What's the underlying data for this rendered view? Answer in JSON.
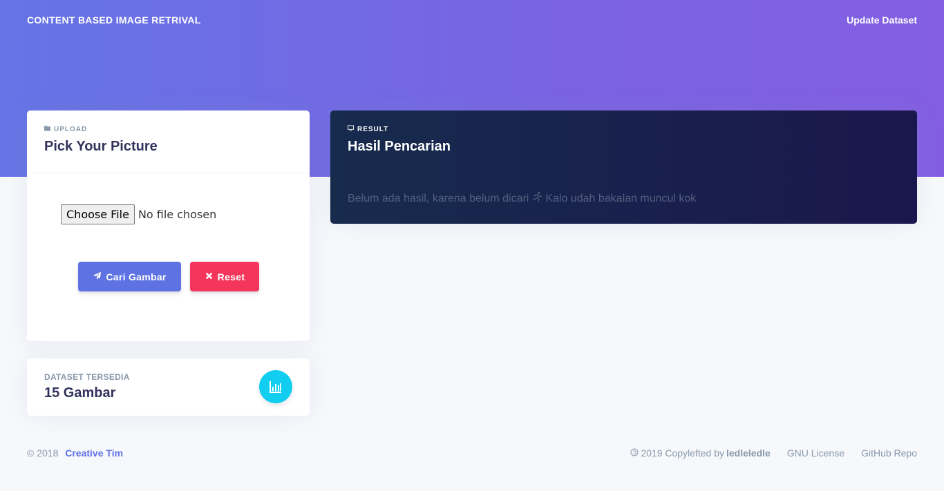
{
  "navbar": {
    "brand": "CONTENT BASED IMAGE RETRIVAL",
    "update_link": "Update Dataset"
  },
  "upload_card": {
    "overline": "UPLOAD",
    "title": "Pick Your Picture",
    "file_button": "Choose File",
    "file_status": "No file chosen",
    "search_button": "Cari Gambar",
    "reset_button": "Reset"
  },
  "stats_card": {
    "label": "DATASET TERSEDIA",
    "value": "15 Gambar"
  },
  "result_card": {
    "overline": "RESULT",
    "title": "Hasil Pencarian",
    "message_before": "Belum ada hasil, karena belum dicari",
    "message_after": "Kalo udah bakalan muncul kok"
  },
  "footer": {
    "copyright": "© 2018",
    "author_link": "Creative Tim",
    "copyleft_prefix": "2019 Copylefted by",
    "copyleft_author": "ledleledle",
    "license_link": "GNU License",
    "repo_link": "GitHub Repo"
  },
  "colors": {
    "primary": "#5e72e4",
    "danger": "#f5365c",
    "info": "#11cdef",
    "hero_start": "#6574e6",
    "hero_end": "#835ee2",
    "result_bg": "#172b4d"
  }
}
